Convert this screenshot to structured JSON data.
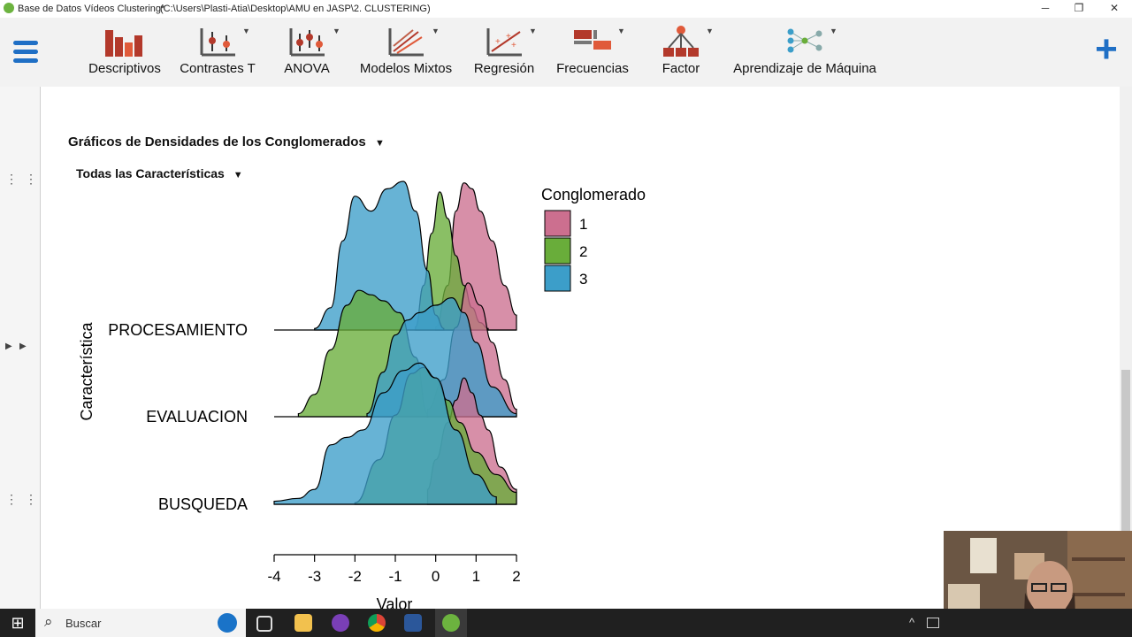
{
  "window": {
    "title": "Base de Datos Vídeos Clustering*",
    "path": "(C:\\Users\\Plasti-Atia\\Desktop\\AMU en JASP\\2. CLUSTERING)",
    "minimize_glyph": "─",
    "restore_glyph": "❐",
    "close_glyph": "✕"
  },
  "ribbon": {
    "items": [
      {
        "label": "Descriptivos"
      },
      {
        "label": "Contrastes T"
      },
      {
        "label": "ANOVA"
      },
      {
        "label": "Modelos Mixtos"
      },
      {
        "label": "Regresión"
      },
      {
        "label": "Frecuencias"
      },
      {
        "label": "Factor"
      },
      {
        "label": "Aprendizaje de Máquina"
      }
    ],
    "dropdown_glyph": "▼",
    "add_glyph": "+"
  },
  "results": {
    "section_title": "Gráficos de Densidades de los Conglomerados",
    "subsection_title": "Todas las Características",
    "collapse_glyph": "▼"
  },
  "chart_data": {
    "type": "area",
    "subtype": "ridgeline density",
    "ylabel": "Característica",
    "xlabel": "Valor",
    "xlim": [
      -4,
      2
    ],
    "xticks": [
      "-4",
      "-3",
      "-2",
      "-1",
      "0",
      "1",
      "2"
    ],
    "categories": [
      "PROCESAMIENTO",
      "EVALUACION",
      "BUSQUEDA"
    ],
    "legend": {
      "title": "Conglomerado",
      "placement": "right",
      "entries": [
        {
          "label": "1",
          "color": "#cc6f8f"
        },
        {
          "label": "2",
          "color": "#69ad3a"
        },
        {
          "label": "3",
          "color": "#3c9ec9"
        }
      ]
    },
    "series": [
      {
        "name": "1",
        "color": "#cc6f8f",
        "ridges": [
          {
            "category": "PROCESAMIENTO",
            "x": [
              0.0,
              0.3,
              0.5,
              0.7,
              0.9,
              1.1,
              1.4,
              1.7,
              2.0
            ],
            "y": [
              0.02,
              0.3,
              0.8,
              0.99,
              0.95,
              0.8,
              0.6,
              0.3,
              0.1
            ]
          },
          {
            "category": "EVALUACION",
            "x": [
              -0.2,
              0.2,
              0.5,
              0.8,
              1.1,
              1.4,
              1.7,
              2.0
            ],
            "y": [
              0.05,
              0.25,
              0.6,
              0.9,
              0.75,
              0.5,
              0.25,
              0.05
            ]
          },
          {
            "category": "BUSQUEDA",
            "x": [
              -0.2,
              0.0,
              0.3,
              0.5,
              0.7,
              0.9,
              1.1,
              1.3,
              1.6,
              2.0
            ],
            "y": [
              0.1,
              0.3,
              0.55,
              0.7,
              0.85,
              0.75,
              0.6,
              0.5,
              0.25,
              0.1
            ]
          }
        ]
      },
      {
        "name": "2",
        "color": "#69ad3a",
        "ridges": [
          {
            "category": "PROCESAMIENTO",
            "x": [
              -0.5,
              -0.3,
              -0.1,
              0.1,
              0.3,
              0.5,
              0.7,
              0.9,
              1.1,
              1.3
            ],
            "y": [
              0.02,
              0.3,
              0.65,
              0.93,
              0.75,
              0.5,
              0.3,
              0.15,
              0.05,
              0.01
            ]
          },
          {
            "category": "EVALUACION",
            "x": [
              -3.4,
              -3.0,
              -2.6,
              -2.2,
              -1.9,
              -1.6,
              -1.3,
              -0.9,
              -0.5,
              -0.2
            ],
            "y": [
              0.02,
              0.15,
              0.45,
              0.75,
              0.85,
              0.82,
              0.78,
              0.7,
              0.4,
              0.02
            ]
          },
          {
            "category": "BUSQUEDA",
            "x": [
              -2.0,
              -1.4,
              -1.0,
              -0.6,
              -0.3,
              0.0,
              0.3,
              0.6,
              1.0,
              1.5,
              2.0
            ],
            "y": [
              0.01,
              0.3,
              0.6,
              0.88,
              0.92,
              0.85,
              0.7,
              0.55,
              0.35,
              0.2,
              0.08
            ]
          }
        ]
      },
      {
        "name": "3",
        "color": "#3c9ec9",
        "ridges": [
          {
            "category": "PROCESAMIENTO",
            "x": [
              -3.0,
              -2.6,
              -2.3,
              -2.0,
              -1.6,
              -1.2,
              -0.8,
              -0.5,
              -0.2,
              0.0,
              0.2
            ],
            "y": [
              0.01,
              0.15,
              0.6,
              0.9,
              0.8,
              0.95,
              1.0,
              0.8,
              0.4,
              0.1,
              0.01
            ]
          },
          {
            "category": "EVALUACION",
            "x": [
              -1.7,
              -1.3,
              -1.0,
              -0.7,
              -0.4,
              0.0,
              0.4,
              0.7,
              1.0,
              1.4,
              2.0
            ],
            "y": [
              0.02,
              0.3,
              0.55,
              0.65,
              0.7,
              0.75,
              0.8,
              0.7,
              0.5,
              0.2,
              0.02
            ]
          },
          {
            "category": "BUSQUEDA",
            "x": [
              -4.0,
              -3.4,
              -3.0,
              -2.6,
              -2.2,
              -1.8,
              -1.3,
              -0.8,
              -0.4,
              0.0,
              0.5,
              1.0,
              1.5
            ],
            "y": [
              0.02,
              0.04,
              0.1,
              0.4,
              0.45,
              0.5,
              0.75,
              0.9,
              0.95,
              0.85,
              0.5,
              0.2,
              0.05
            ]
          }
        ]
      }
    ]
  },
  "taskbar": {
    "search_placeholder": "Buscar",
    "start_glyph": "⊞",
    "search_glyph": "⌕",
    "tray_up_glyph": "^"
  }
}
